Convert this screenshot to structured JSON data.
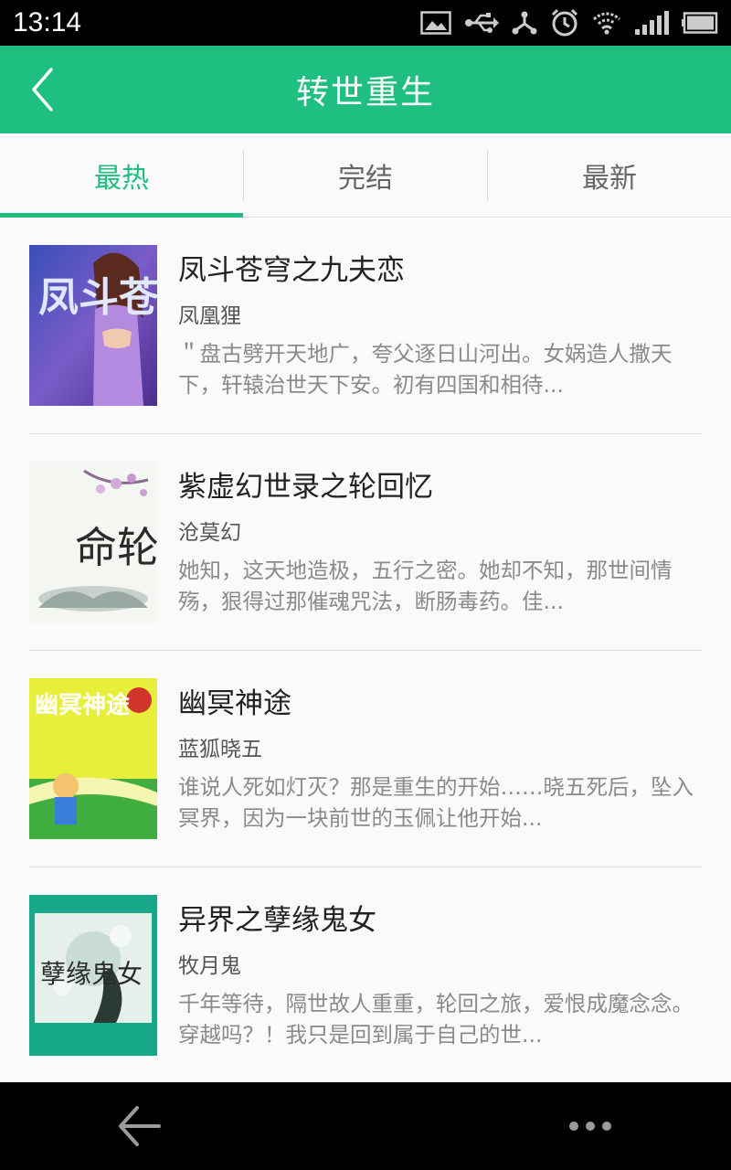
{
  "status_bar": {
    "time": "13:14",
    "icons": [
      "image-icon",
      "usb-icon",
      "usb-tether-icon",
      "alarm-icon",
      "wifi-icon",
      "signal-icon",
      "battery-icon"
    ]
  },
  "app_bar": {
    "title": "转世重生",
    "back_icon": "chevron-left-icon"
  },
  "tabs": [
    {
      "label": "最热",
      "active": true
    },
    {
      "label": "完结",
      "active": false
    },
    {
      "label": "最新",
      "active": false
    }
  ],
  "books": [
    {
      "title": "凤斗苍穹之九夫恋",
      "author": "凤凰狸",
      "description": "＂盘古劈开天地广，夸父逐日山河出。女娲造人撒天下，轩辕治世天下安。初有四国和相待...",
      "cover_text": "凤斗苍穹"
    },
    {
      "title": "紫虚幻世录之轮回忆",
      "author": "沧莫幻",
      "description": "她知，这天地造极，五行之密。她却不知，那世间情殇，狠得过那催魂咒法，断肠毒药。佳...",
      "cover_text": "命轮"
    },
    {
      "title": "幽冥神途",
      "author": "蓝狐晓五",
      "description": "谁说人死如灯灭？那是重生的开始……晓五死后，坠入冥界，因为一块前世的玉佩让他开始...",
      "cover_text": "幽冥神途"
    },
    {
      "title": "异界之孽缘鬼女",
      "author": "牧月鬼",
      "description": "千年等待，隔世故人重重，轮回之旅，爱恨成魔念念。穿越吗？！我只是回到属于自己的世...",
      "cover_text": "孽缘鬼女"
    }
  ],
  "nav_bar": {
    "back_icon": "arrow-left-icon",
    "more_icon": "more-dots-icon"
  },
  "colors": {
    "accent": "#1ebf81",
    "title_text": "#222222",
    "desc_text": "#8a8a8a"
  }
}
